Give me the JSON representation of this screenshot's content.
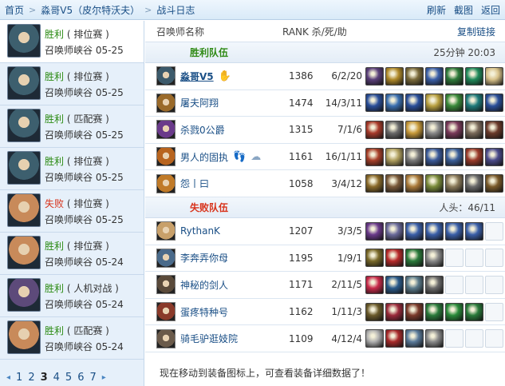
{
  "topbar": {
    "breadcrumb": [
      "首页",
      "淼哥V5（皮尔特沃夫）",
      "战斗日志"
    ],
    "links": [
      "刷新",
      "截图",
      "返回"
    ]
  },
  "sidebar": {
    "matches": [
      {
        "result": "胜利",
        "win": true,
        "mode": "( 排位赛 )",
        "map": "召唤师峡谷",
        "date": "05-25",
        "color": "#3d5f6e"
      },
      {
        "result": "胜利",
        "win": true,
        "mode": "( 排位赛 )",
        "map": "召唤师峡谷",
        "date": "05-25",
        "color": "#3d5f6e"
      },
      {
        "result": "胜利",
        "win": true,
        "mode": "( 匹配赛 )",
        "map": "召唤师峡谷",
        "date": "05-25",
        "color": "#3d5f6e"
      },
      {
        "result": "胜利",
        "win": true,
        "mode": "( 排位赛 )",
        "map": "召唤师峡谷",
        "date": "05-25",
        "color": "#3d5f6e"
      },
      {
        "result": "失败",
        "win": false,
        "mode": "( 排位赛 )",
        "map": "召唤师峡谷",
        "date": "05-25",
        "color": "#c88a5a"
      },
      {
        "result": "胜利",
        "win": true,
        "mode": "( 排位赛 )",
        "map": "召唤师峡谷",
        "date": "05-24",
        "color": "#c88a5a"
      },
      {
        "result": "胜利",
        "win": true,
        "mode": "( 人机对战 )",
        "map": "召唤师峡谷",
        "date": "05-24",
        "color": "#5d4a7a"
      },
      {
        "result": "胜利",
        "win": true,
        "mode": "( 匹配赛 )",
        "map": "召唤师峡谷",
        "date": "05-24",
        "color": "#c88a5a"
      }
    ],
    "pager": {
      "prev": "◂",
      "pages": [
        "1",
        "2",
        "3",
        "4",
        "5",
        "6",
        "7"
      ],
      "current": "3",
      "next": "▸"
    }
  },
  "main": {
    "headers": {
      "name": "召唤师名称",
      "rank": "RANK 杀/死/助",
      "copy": "复制链接"
    },
    "win_team": {
      "label": "胜利队伍",
      "right": "25分钟 20:03"
    },
    "lose_team": {
      "label": "失败队伍",
      "right": "人头：46/11"
    },
    "win_players": [
      {
        "name": "淼哥V5",
        "rank": "1386",
        "kda": "6/2/20",
        "me": true,
        "badges": [
          "✋"
        ],
        "avatar": "#3c5a6b",
        "items": [
          "#5a3f7a",
          "#b08a2a",
          "#7a6a3a",
          "#3a5fa8",
          "#2e7a3a",
          "#1f8a5a",
          "#d8c28a"
        ]
      },
      {
        "name": "屠夫阿翔",
        "rank": "1474",
        "kda": "14/3/11",
        "me": false,
        "badges": [],
        "avatar": "#9a6a2a",
        "items": [
          "#2a4f9a",
          "#3a6fb0",
          "#2a4f9a",
          "#b8a040",
          "#3a8a3a",
          "#1e7a7a",
          "#2a4f9a"
        ]
      },
      {
        "name": "杀戮0公爵",
        "rank": "1315",
        "kda": "7/1/6",
        "me": false,
        "badges": [],
        "avatar": "#6a3a8a",
        "items": [
          "#a83a2a",
          "#6a6a6a",
          "#c89a3a",
          "#8a8a8a",
          "#7a3a5a",
          "#7a6a5a",
          "#6a3a2a"
        ]
      },
      {
        "name": "男人的固执",
        "rank": "1161",
        "kda": "16/1/11",
        "me": false,
        "badges": [
          "👣",
          "☁"
        ],
        "avatar": "#b8641e",
        "items": [
          "#a8402a",
          "#b0a060",
          "#7a7a7a",
          "#3a5a9a",
          "#3a5f9a",
          "#9a3a2a",
          "#4a4a8a"
        ]
      },
      {
        "name": "怨丨曰",
        "rank": "1058",
        "kda": "3/4/12",
        "me": false,
        "badges": [],
        "avatar": "#c07a28",
        "items": [
          "#8a6a2a",
          "#7a5a3a",
          "#aa7a3a",
          "#7a8a3a",
          "#8a7a5a",
          "#6a6a6a",
          "#7a5a2a"
        ]
      }
    ],
    "lose_players": [
      {
        "name": "RythanK",
        "rank": "1207",
        "kda": "3/3/5",
        "me": false,
        "badges": [],
        "avatar": "#c8a06a",
        "items": [
          "#6a3a8a",
          "#6a6a9a",
          "#3a5fa8",
          "#3a5fa8",
          "#3a5fa8",
          "#3a5fa8",
          ""
        ]
      },
      {
        "name": "李奔弄你母",
        "rank": "1195",
        "kda": "1/9/1",
        "me": false,
        "badges": [],
        "avatar": "#4a6a8a",
        "items": [
          "#7a6a2a",
          "#b82a2a",
          "#2a7a3a",
          "#8a8a8a",
          "",
          "",
          ""
        ]
      },
      {
        "name": "神秘的剑人",
        "rank": "1171",
        "kda": "2/11/5",
        "me": false,
        "badges": [],
        "avatar": "#5a4a3a",
        "items": [
          "#c82a4a",
          "#2a5a8a",
          "#5a7a8a",
          "#6a6a6a",
          "",
          "",
          ""
        ]
      },
      {
        "name": "蛋疼特种号",
        "rank": "1162",
        "kda": "1/11/3",
        "me": false,
        "badges": [],
        "avatar": "#8a3a2a",
        "items": [
          "#6a5a2a",
          "#9a2a3a",
          "#7a3a2a",
          "#2a7a3a",
          "#2a8a3a",
          "#2a7a3a",
          ""
        ]
      },
      {
        "name": "骑毛驴逛妓院",
        "rank": "1109",
        "kda": "4/12/4",
        "me": false,
        "badges": [],
        "avatar": "#6a5a4a",
        "items": [
          "#b0b0b0",
          "#a82a2a",
          "#5a7a9a",
          "#8a8a8a",
          "",
          "",
          ""
        ]
      }
    ],
    "hint": "现在移动到装备图标上，可查看装备详细数据了！"
  }
}
